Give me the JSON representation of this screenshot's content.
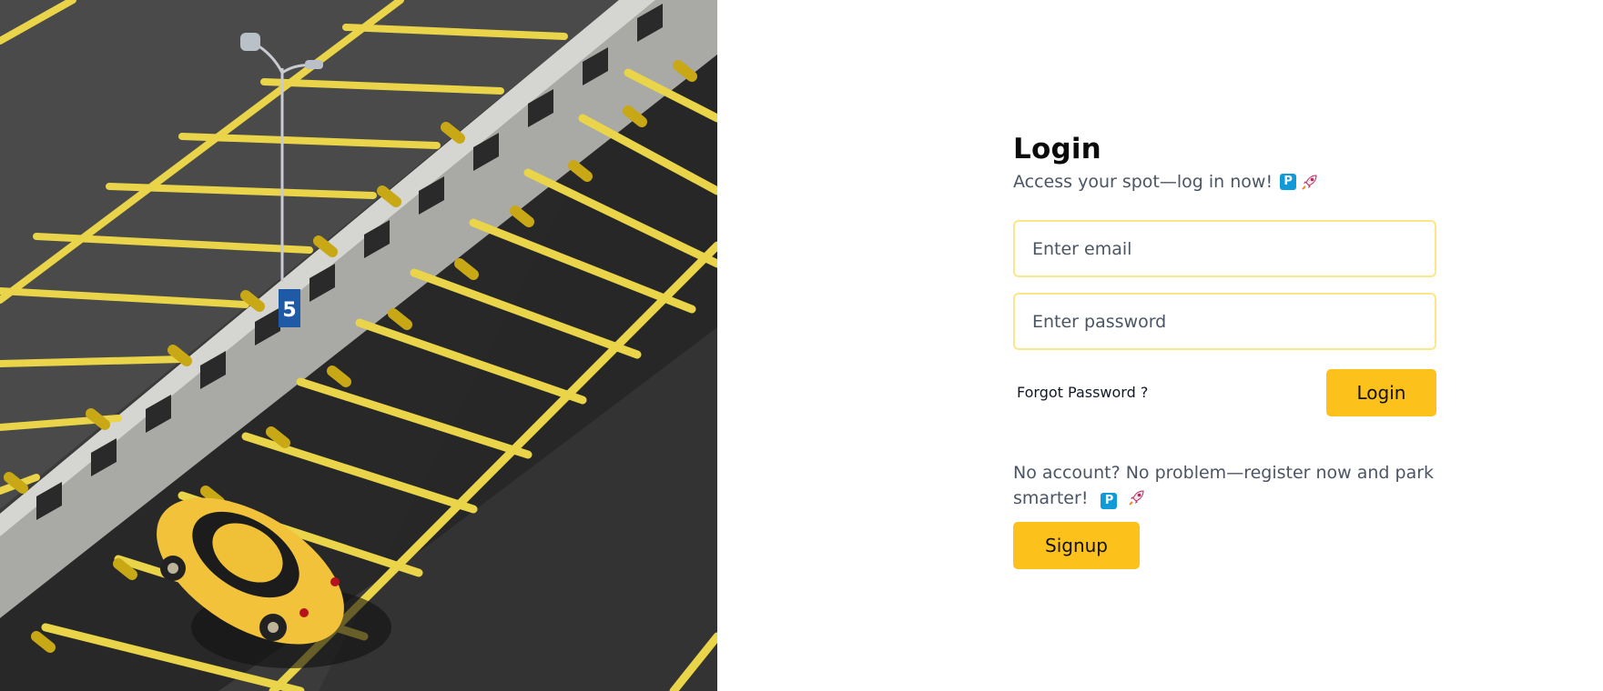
{
  "hero": {
    "image": "parking-garage-yellow-car-photo",
    "level_sign": "5"
  },
  "login": {
    "title": "Login",
    "subtitle": "Access your spot—log in now!",
    "subtitle_badge": "P",
    "email_placeholder": "Enter email",
    "password_placeholder": "Enter password",
    "forgot_label": "Forgot Password ?",
    "login_button": "Login"
  },
  "signup": {
    "promo_text": "No account? No problem—register now and park smarter!",
    "promo_badge": "P",
    "signup_button": "Signup"
  },
  "colors": {
    "accent": "#fcc21b",
    "input_border": "#fde68a",
    "badge": "#119ad8",
    "text_muted": "#4b5563"
  }
}
